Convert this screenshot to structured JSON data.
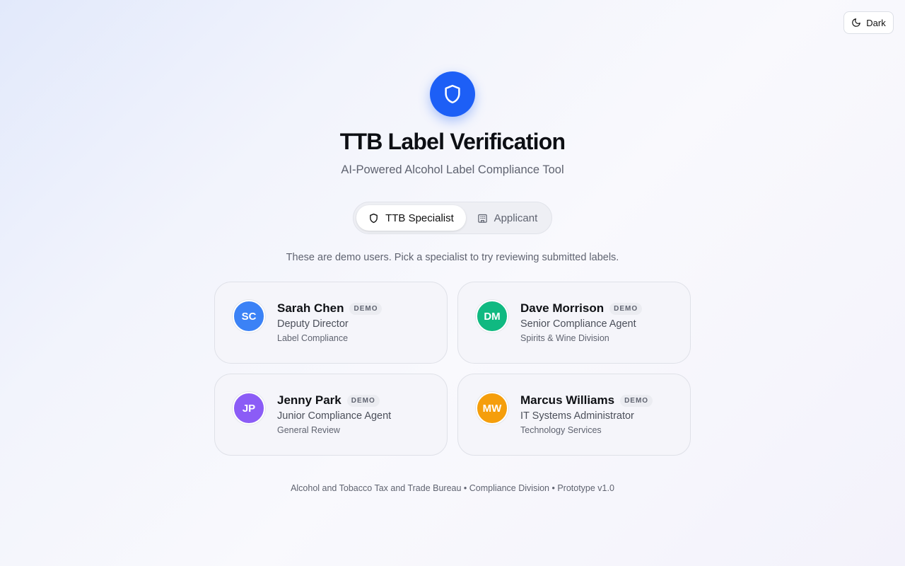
{
  "theme_toggle": {
    "label": "Dark",
    "icon": "moon-icon"
  },
  "header": {
    "logo_icon": "shield-icon",
    "title": "TTB Label Verification",
    "subtitle": "AI-Powered Alcohol Label Compliance Tool"
  },
  "role_toggle": {
    "options": [
      {
        "label": "TTB Specialist",
        "icon": "shield-icon",
        "active": true
      },
      {
        "label": "Applicant",
        "icon": "building-icon",
        "active": false
      }
    ]
  },
  "hint": "These are demo users. Pick a specialist to try reviewing submitted labels.",
  "users": [
    {
      "initials": "SC",
      "name": "Sarah Chen",
      "badge": "DEMO",
      "role": "Deputy Director",
      "department": "Label Compliance",
      "color": "#3b82f6"
    },
    {
      "initials": "DM",
      "name": "Dave Morrison",
      "badge": "DEMO",
      "role": "Senior Compliance Agent",
      "department": "Spirits & Wine Division",
      "color": "#10b981"
    },
    {
      "initials": "JP",
      "name": "Jenny Park",
      "badge": "DEMO",
      "role": "Junior Compliance Agent",
      "department": "General Review",
      "color": "#8b5cf6"
    },
    {
      "initials": "MW",
      "name": "Marcus Williams",
      "badge": "DEMO",
      "role": "IT Systems Administrator",
      "department": "Technology Services",
      "color": "#f59e0b"
    }
  ],
  "footer": "Alcohol and Tobacco Tax and Trade Bureau • Compliance Division • Prototype v1.0",
  "colors": {
    "accent": "#1d5ff6"
  }
}
